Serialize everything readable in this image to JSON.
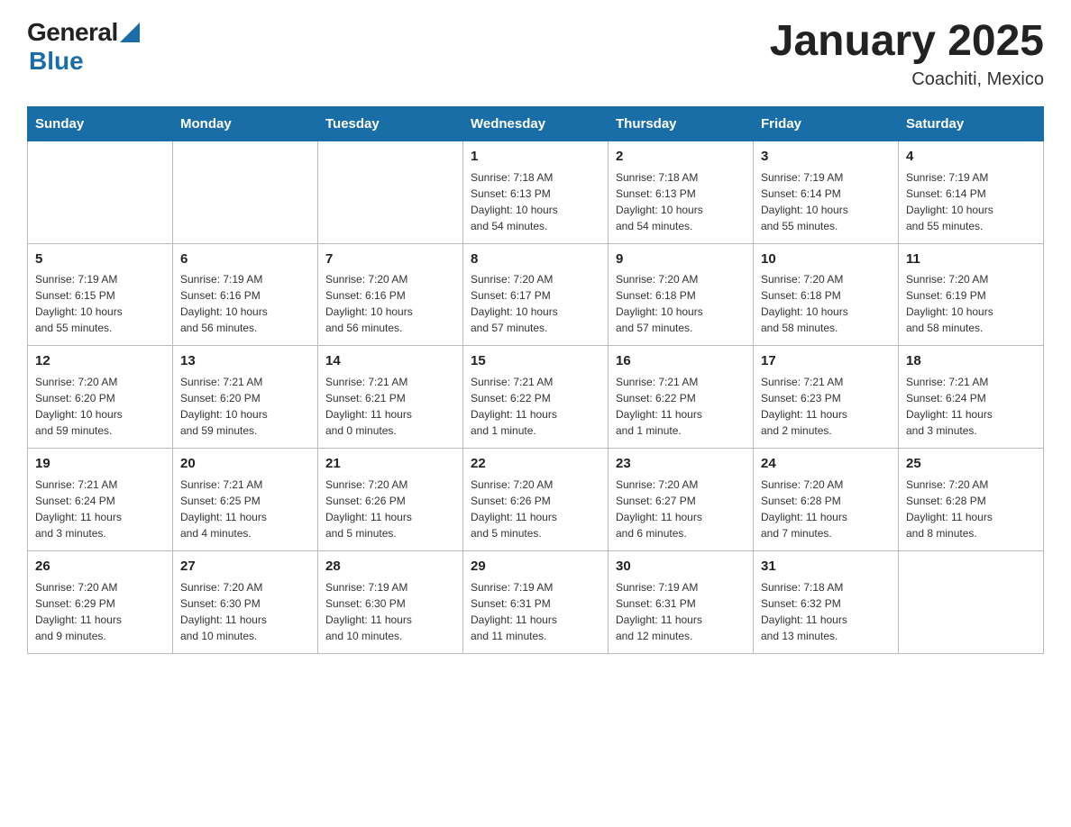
{
  "header": {
    "logo_general": "General",
    "logo_blue": "Blue",
    "title": "January 2025",
    "subtitle": "Coachiti, Mexico"
  },
  "days_of_week": [
    "Sunday",
    "Monday",
    "Tuesday",
    "Wednesday",
    "Thursday",
    "Friday",
    "Saturday"
  ],
  "weeks": [
    [
      {
        "day": "",
        "info": ""
      },
      {
        "day": "",
        "info": ""
      },
      {
        "day": "",
        "info": ""
      },
      {
        "day": "1",
        "info": "Sunrise: 7:18 AM\nSunset: 6:13 PM\nDaylight: 10 hours\nand 54 minutes."
      },
      {
        "day": "2",
        "info": "Sunrise: 7:18 AM\nSunset: 6:13 PM\nDaylight: 10 hours\nand 54 minutes."
      },
      {
        "day": "3",
        "info": "Sunrise: 7:19 AM\nSunset: 6:14 PM\nDaylight: 10 hours\nand 55 minutes."
      },
      {
        "day": "4",
        "info": "Sunrise: 7:19 AM\nSunset: 6:14 PM\nDaylight: 10 hours\nand 55 minutes."
      }
    ],
    [
      {
        "day": "5",
        "info": "Sunrise: 7:19 AM\nSunset: 6:15 PM\nDaylight: 10 hours\nand 55 minutes."
      },
      {
        "day": "6",
        "info": "Sunrise: 7:19 AM\nSunset: 6:16 PM\nDaylight: 10 hours\nand 56 minutes."
      },
      {
        "day": "7",
        "info": "Sunrise: 7:20 AM\nSunset: 6:16 PM\nDaylight: 10 hours\nand 56 minutes."
      },
      {
        "day": "8",
        "info": "Sunrise: 7:20 AM\nSunset: 6:17 PM\nDaylight: 10 hours\nand 57 minutes."
      },
      {
        "day": "9",
        "info": "Sunrise: 7:20 AM\nSunset: 6:18 PM\nDaylight: 10 hours\nand 57 minutes."
      },
      {
        "day": "10",
        "info": "Sunrise: 7:20 AM\nSunset: 6:18 PM\nDaylight: 10 hours\nand 58 minutes."
      },
      {
        "day": "11",
        "info": "Sunrise: 7:20 AM\nSunset: 6:19 PM\nDaylight: 10 hours\nand 58 minutes."
      }
    ],
    [
      {
        "day": "12",
        "info": "Sunrise: 7:20 AM\nSunset: 6:20 PM\nDaylight: 10 hours\nand 59 minutes."
      },
      {
        "day": "13",
        "info": "Sunrise: 7:21 AM\nSunset: 6:20 PM\nDaylight: 10 hours\nand 59 minutes."
      },
      {
        "day": "14",
        "info": "Sunrise: 7:21 AM\nSunset: 6:21 PM\nDaylight: 11 hours\nand 0 minutes."
      },
      {
        "day": "15",
        "info": "Sunrise: 7:21 AM\nSunset: 6:22 PM\nDaylight: 11 hours\nand 1 minute."
      },
      {
        "day": "16",
        "info": "Sunrise: 7:21 AM\nSunset: 6:22 PM\nDaylight: 11 hours\nand 1 minute."
      },
      {
        "day": "17",
        "info": "Sunrise: 7:21 AM\nSunset: 6:23 PM\nDaylight: 11 hours\nand 2 minutes."
      },
      {
        "day": "18",
        "info": "Sunrise: 7:21 AM\nSunset: 6:24 PM\nDaylight: 11 hours\nand 3 minutes."
      }
    ],
    [
      {
        "day": "19",
        "info": "Sunrise: 7:21 AM\nSunset: 6:24 PM\nDaylight: 11 hours\nand 3 minutes."
      },
      {
        "day": "20",
        "info": "Sunrise: 7:21 AM\nSunset: 6:25 PM\nDaylight: 11 hours\nand 4 minutes."
      },
      {
        "day": "21",
        "info": "Sunrise: 7:20 AM\nSunset: 6:26 PM\nDaylight: 11 hours\nand 5 minutes."
      },
      {
        "day": "22",
        "info": "Sunrise: 7:20 AM\nSunset: 6:26 PM\nDaylight: 11 hours\nand 5 minutes."
      },
      {
        "day": "23",
        "info": "Sunrise: 7:20 AM\nSunset: 6:27 PM\nDaylight: 11 hours\nand 6 minutes."
      },
      {
        "day": "24",
        "info": "Sunrise: 7:20 AM\nSunset: 6:28 PM\nDaylight: 11 hours\nand 7 minutes."
      },
      {
        "day": "25",
        "info": "Sunrise: 7:20 AM\nSunset: 6:28 PM\nDaylight: 11 hours\nand 8 minutes."
      }
    ],
    [
      {
        "day": "26",
        "info": "Sunrise: 7:20 AM\nSunset: 6:29 PM\nDaylight: 11 hours\nand 9 minutes."
      },
      {
        "day": "27",
        "info": "Sunrise: 7:20 AM\nSunset: 6:30 PM\nDaylight: 11 hours\nand 10 minutes."
      },
      {
        "day": "28",
        "info": "Sunrise: 7:19 AM\nSunset: 6:30 PM\nDaylight: 11 hours\nand 10 minutes."
      },
      {
        "day": "29",
        "info": "Sunrise: 7:19 AM\nSunset: 6:31 PM\nDaylight: 11 hours\nand 11 minutes."
      },
      {
        "day": "30",
        "info": "Sunrise: 7:19 AM\nSunset: 6:31 PM\nDaylight: 11 hours\nand 12 minutes."
      },
      {
        "day": "31",
        "info": "Sunrise: 7:18 AM\nSunset: 6:32 PM\nDaylight: 11 hours\nand 13 minutes."
      },
      {
        "day": "",
        "info": ""
      }
    ]
  ]
}
